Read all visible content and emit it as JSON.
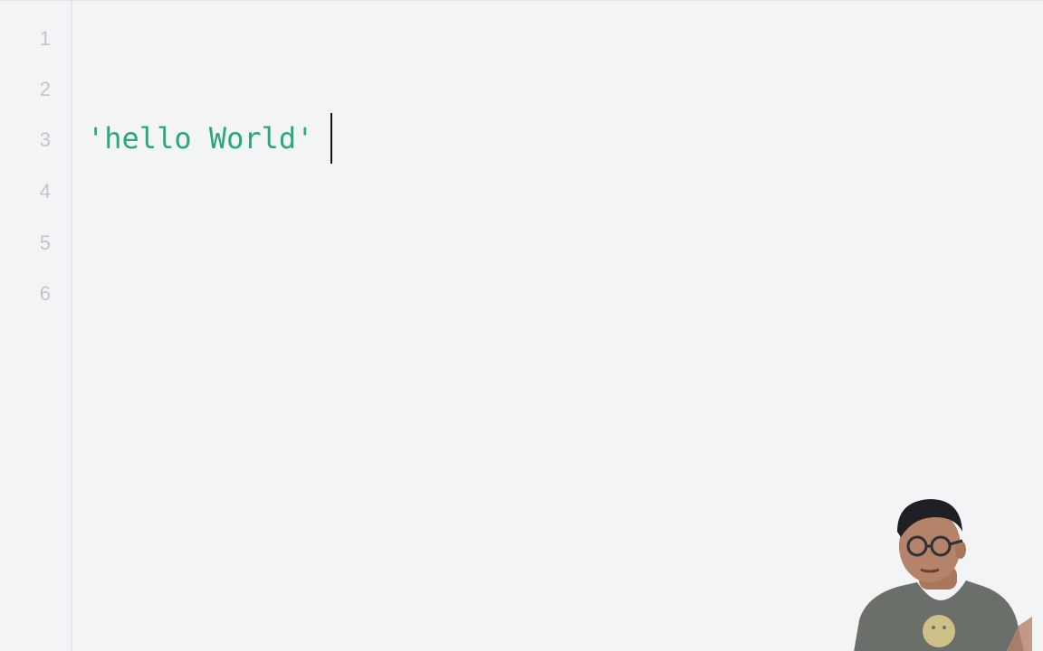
{
  "editor": {
    "line_numbers": [
      "1",
      "2",
      "3",
      "4",
      "5",
      "6"
    ],
    "lines": [
      "",
      "",
      "'hello World'",
      "",
      "",
      ""
    ],
    "string_color": "#2aa876"
  },
  "overlay": {
    "webcam_icon": "presenter-webcam"
  }
}
